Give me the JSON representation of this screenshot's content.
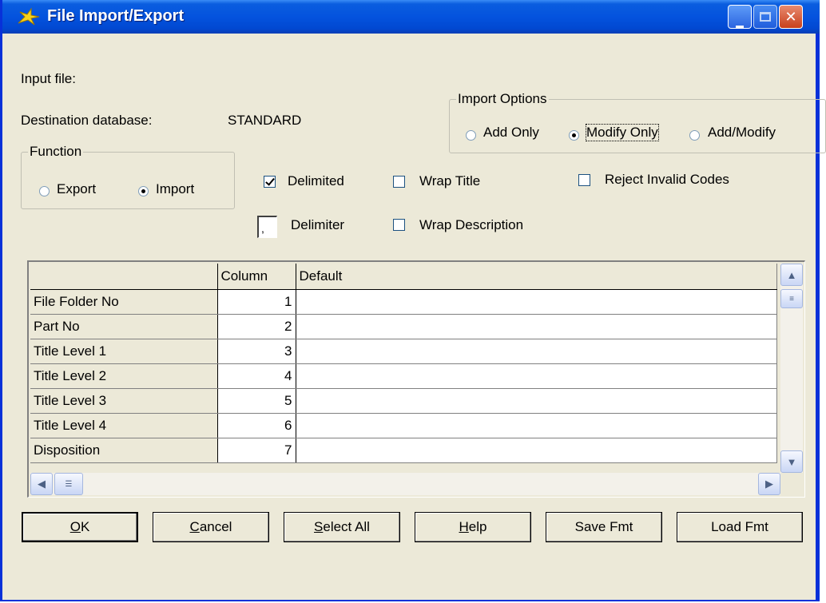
{
  "window": {
    "title": "File Import/Export",
    "icon": "xiphos-star-icon",
    "controls": [
      "minimize",
      "maximize",
      "close"
    ],
    "close_glyph": "✕",
    "minimize_glyph": "▁"
  },
  "labels": {
    "input_file": "Input file:",
    "destination_database": "Destination database:",
    "destination_value": "STANDARD"
  },
  "function_group": {
    "legend": "Function",
    "export_label": "Export",
    "import_label": "Import",
    "selected": "Import"
  },
  "import_options": {
    "legend": "Import Options",
    "add_only": "Add Only",
    "modify_only": "Modify Only",
    "add_modify": "Add/Modify",
    "selected": "Modify Only"
  },
  "checkboxes": {
    "delimited": {
      "label": "Delimited",
      "checked": true
    },
    "wrap_title": {
      "label": "Wrap Title",
      "checked": false
    },
    "reject_invalid_codes": {
      "label": "Reject Invalid Codes",
      "checked": false
    },
    "wrap_description": {
      "label": "Wrap Description",
      "checked": false
    }
  },
  "delimiter": {
    "label": "Delimiter",
    "value": ","
  },
  "grid": {
    "headers": [
      "",
      "Column",
      "Default"
    ],
    "rows": [
      {
        "field": "File Folder No",
        "column": "1",
        "default": ""
      },
      {
        "field": "Part No",
        "column": "2",
        "default": ""
      },
      {
        "field": "Title Level 1",
        "column": "3",
        "default": ""
      },
      {
        "field": "Title Level 2",
        "column": "4",
        "default": ""
      },
      {
        "field": "Title Level 3",
        "column": "5",
        "default": ""
      },
      {
        "field": "Title Level 4",
        "column": "6",
        "default": ""
      },
      {
        "field": "Disposition",
        "column": "7",
        "default": ""
      }
    ]
  },
  "buttons": {
    "ok": {
      "label": "OK",
      "accel": "O"
    },
    "cancel": {
      "label": "Cancel",
      "accel": "C"
    },
    "select_all": {
      "label": "Select All",
      "accel": "S"
    },
    "help": {
      "label": "Help",
      "accel": "H"
    },
    "save_fmt": {
      "label": "Save Fmt"
    },
    "load_fmt": {
      "label": "Load Fmt"
    }
  },
  "colors": {
    "titlebar": "#0453de",
    "face": "#ece9d8",
    "close_button": "#c8401c"
  }
}
